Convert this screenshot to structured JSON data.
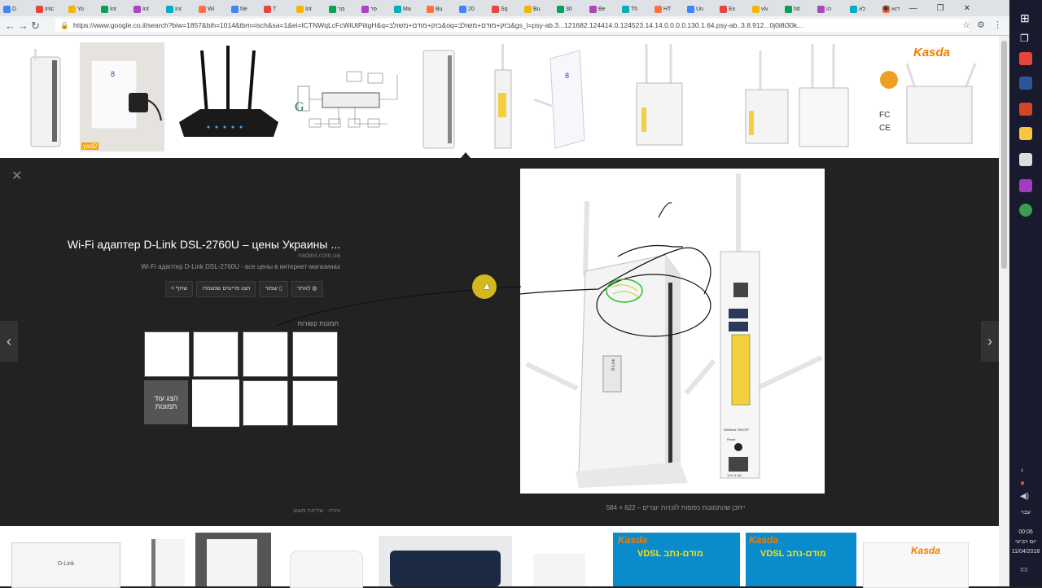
{
  "browser": {
    "url": "https://www.google.co.il/search?biw=1857&bih=1014&tbm=isch&sa=1&ei=ICTNWqLcFcWiUtPiitgH&q=בזק+מודם+משולב&oq=בזק+מודם+משולב&gs_l=psy-ab.3...121682.124414.0.124523.14.14.0.0.0.0.130.1.64.psy-ab..3.8.912...0j0i8i30k...",
    "tabs": [
      "D",
      "Intc",
      "Yo",
      "Int",
      "Int",
      "Int",
      "Wi",
      "Ne",
      "T",
      "Int",
      "מר",
      "פר",
      "Ma",
      "Bu",
      "20",
      "Sq",
      "Bu",
      "30",
      "Be",
      "Th",
      "HT",
      "Un",
      "Ex",
      "viv",
      "htt",
      "הו",
      "לא",
      "דוא"
    ]
  },
  "panel": {
    "title": "Wi-Fi адаптер D-Link DSL-2760U – цены Украины ...",
    "site": "nadavi.com.ua",
    "description": "Wi-Fi адаптер D-Link DSL-2760U - все цены в интернет-магазинах",
    "buttons": {
      "visit": "לאתר",
      "save": "שמור",
      "view_saved": "הצג פריטים שנשמרו",
      "share": "שתף"
    },
    "related_title": "תמונות קשורות",
    "more_images": "הצג עוד תמונות",
    "caption": "ייתכן שהתמונות כפופות לזכויות יוצרים – 622 × 584",
    "footer": "עזרה · שליחת משוב",
    "main_image": {
      "device_label": "D-Link",
      "port_labels": [
        "Wireless ON/OFF",
        "Reset",
        "12V=1.5A"
      ]
    }
  },
  "thumbnails": {
    "top_badge": "yad2",
    "kasda": "Kasda",
    "vdsl": "VDSL מודם-נתב",
    "dlink": "D-Link"
  },
  "system": {
    "lang": "עבר",
    "time": "00:06",
    "day": "יום רביעי",
    "date": "11/04/2018"
  },
  "colors": {
    "panel_bg": "#222222",
    "cursor_highlight": "#f2d21e",
    "kasda_orange": "#ef7d00",
    "port_yellow": "#f4d03f"
  }
}
